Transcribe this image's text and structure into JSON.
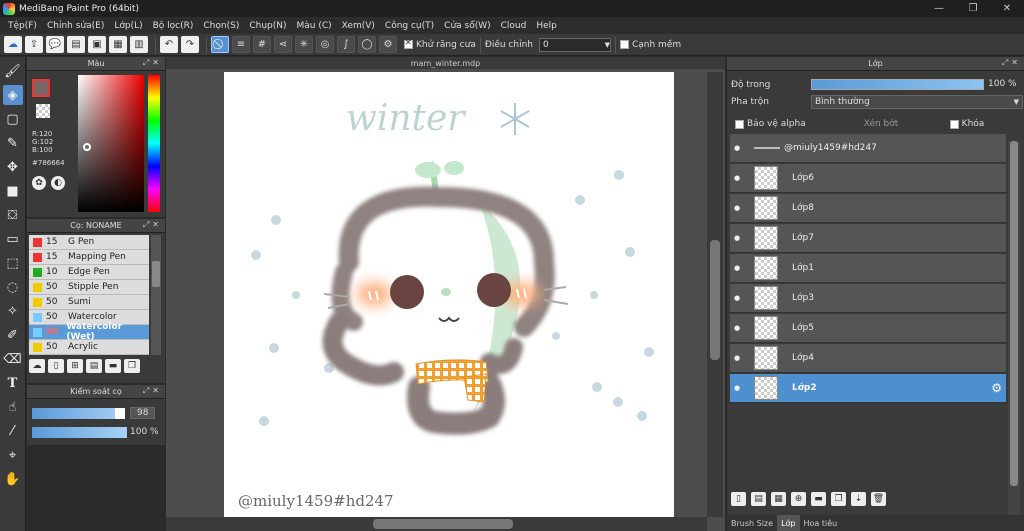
{
  "window": {
    "title": "MediBang Paint Pro (64bit)",
    "minimize": "—",
    "maximize": "❐",
    "close": "✕"
  },
  "menu": [
    "Tệp(F)",
    "Chỉnh sửa(E)",
    "Lớp(L)",
    "Bộ lọc(R)",
    "Chọn(S)",
    "Chụp(N)",
    "Màu (C)",
    "Xem(V)",
    "Công cụ(T)",
    "Cửa sổ(W)",
    "Cloud",
    "Help"
  ],
  "toolbar": {
    "antialias_label": "Khử răng cưa",
    "adjust_label": "Điều chỉnh",
    "adjust_value": "0",
    "soft_edge_label": "Cạnh mềm"
  },
  "color_panel": {
    "title": "Màu",
    "r": "R:120",
    "g": "G:102",
    "b": "B:100",
    "hex": "#786664",
    "fg_color": "#786664"
  },
  "brush_panel": {
    "title": "Cọ: NONAME",
    "brushes": [
      {
        "size": "15",
        "name": "G Pen",
        "color": "#e33"
      },
      {
        "size": "15",
        "name": "Mapping Pen",
        "color": "#e33"
      },
      {
        "size": "10",
        "name": "Edge Pen",
        "color": "#2a2"
      },
      {
        "size": "50",
        "name": "Stipple Pen",
        "color": "#ec0"
      },
      {
        "size": "50",
        "name": "Sumi",
        "color": "#ec0"
      },
      {
        "size": "50",
        "name": "Watercolor",
        "color": "#7cf"
      },
      {
        "size": "58",
        "name": "Watercolor (Wet)",
        "color": "#7cf"
      },
      {
        "size": "50",
        "name": "Acrylic",
        "color": "#ec0"
      }
    ]
  },
  "brush_control": {
    "title": "Kiểm soát cọ",
    "size_value": "98",
    "opacity_value": "100 %",
    "size_fraction": 0.98,
    "opacity_fraction": 1.0
  },
  "canvas": {
    "filename": "mam_winter.mdp",
    "watermark": "@miuly1459#hd247"
  },
  "layer_panel": {
    "title": "Lớp",
    "opacity_label": "Độ trong",
    "opacity_value": "100 %",
    "blend_label": "Pha trộn",
    "blend_value": "Bình thường",
    "protect_alpha": "Bảo vệ alpha",
    "clipping": "Xén bớt",
    "lock": "Khóa",
    "layers": [
      {
        "name": "@miuly1459#hd247",
        "type": "text"
      },
      {
        "name": "Lớp6"
      },
      {
        "name": "Lớp8"
      },
      {
        "name": "Lớp7"
      },
      {
        "name": "Lớp1"
      },
      {
        "name": "Lớp3"
      },
      {
        "name": "Lớp5"
      },
      {
        "name": "Lớp4"
      },
      {
        "name": "Lớp2",
        "selected": true
      }
    ]
  },
  "bottom_tabs": [
    "Brush Size",
    "Lớp",
    "Hoa tiêu"
  ]
}
